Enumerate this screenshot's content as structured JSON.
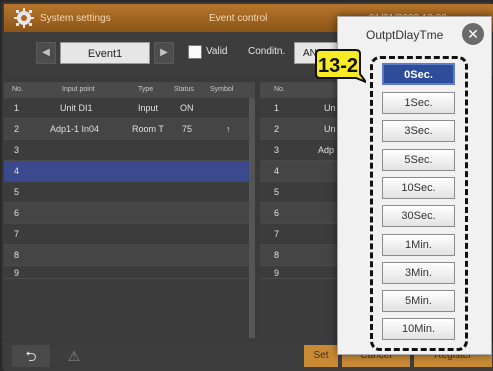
{
  "titlebar": {
    "title": "System settings",
    "center": "Event control",
    "right": "01/01/2000 12:00"
  },
  "event": {
    "name": "Event1",
    "valid_label": "Valid",
    "condition_label": "Conditn.",
    "condition_value": "AND"
  },
  "table": {
    "headers": [
      "No.",
      "Input point",
      "Type",
      "Status",
      "Symbol"
    ],
    "rows": [
      {
        "no": "1",
        "point": "Unit DI1",
        "type": "Input",
        "status": "ON",
        "symbol": ""
      },
      {
        "no": "2",
        "point": "Adp1-1 In04",
        "type": "Room T",
        "status": "75",
        "symbol": "↑"
      },
      {
        "no": "3",
        "point": "",
        "type": "",
        "status": "",
        "symbol": ""
      },
      {
        "no": "4",
        "point": "",
        "type": "",
        "status": "",
        "symbol": ""
      },
      {
        "no": "5",
        "point": "",
        "type": "",
        "status": "",
        "symbol": ""
      },
      {
        "no": "6",
        "point": "",
        "type": "",
        "status": "",
        "symbol": ""
      },
      {
        "no": "7",
        "point": "",
        "type": "",
        "status": "",
        "symbol": ""
      },
      {
        "no": "8",
        "point": "",
        "type": "",
        "status": "",
        "symbol": ""
      },
      {
        "no": "9",
        "point": "",
        "type": "",
        "status": "",
        "symbol": ""
      }
    ]
  },
  "right_table": {
    "header_no": "No.",
    "rows": [
      {
        "no": "1",
        "point": "Un"
      },
      {
        "no": "2",
        "point": "Un"
      },
      {
        "no": "3",
        "point": "Adp"
      },
      {
        "no": "4",
        "point": ""
      },
      {
        "no": "5",
        "point": ""
      },
      {
        "no": "6",
        "point": ""
      },
      {
        "no": "7",
        "point": ""
      },
      {
        "no": "8",
        "point": ""
      },
      {
        "no": "9",
        "point": ""
      }
    ]
  },
  "bottom": {
    "back": "⮌",
    "warning": "⚠",
    "set": "Set",
    "cancel": "Cancel",
    "register": "Register"
  },
  "popup": {
    "title": "OutptDlayTme",
    "callout": "13-2",
    "options": [
      "0Sec.",
      "1Sec.",
      "3Sec.",
      "5Sec.",
      "10Sec.",
      "30Sec.",
      "1Min.",
      "3Min.",
      "5Min.",
      "10Min."
    ],
    "selected": "0Sec."
  },
  "colors": {
    "titlebar": "#a86a24",
    "selected_row": "#3b4a8c",
    "selected_option": "#2f4c9a",
    "callout_fill": "#f7ea27"
  }
}
